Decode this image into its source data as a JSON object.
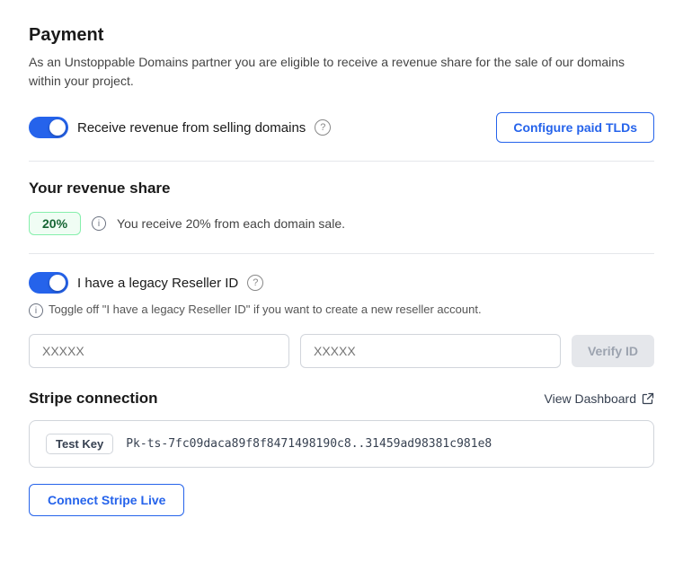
{
  "page": {
    "title": "Payment",
    "description": "As an Unstoppable Domains partner you are eligible to receive a revenue share for the sale of our domains within your project."
  },
  "revenue_toggle": {
    "label": "Receive revenue from selling domains",
    "enabled": true
  },
  "configure_button": {
    "label": "Configure paid TLDs"
  },
  "revenue_share": {
    "heading": "Your revenue share",
    "badge": "20%",
    "info_text": "You receive 20% from each domain sale."
  },
  "legacy_reseller": {
    "label": "I have a legacy Reseller ID",
    "enabled": true,
    "note": "Toggle off \"I have a legacy Reseller ID\" if you want to create a new reseller account.",
    "input1_placeholder": "XXXXX",
    "input2_placeholder": "XXXXX",
    "verify_button": "Verify ID"
  },
  "stripe": {
    "heading": "Stripe connection",
    "view_dashboard": "View Dashboard",
    "test_key_label": "Test Key",
    "test_key_value": "Pk-ts-7fc09daca89f8f8471498190c8..31459ad98381c981e8",
    "connect_button": "Connect Stripe Live"
  }
}
